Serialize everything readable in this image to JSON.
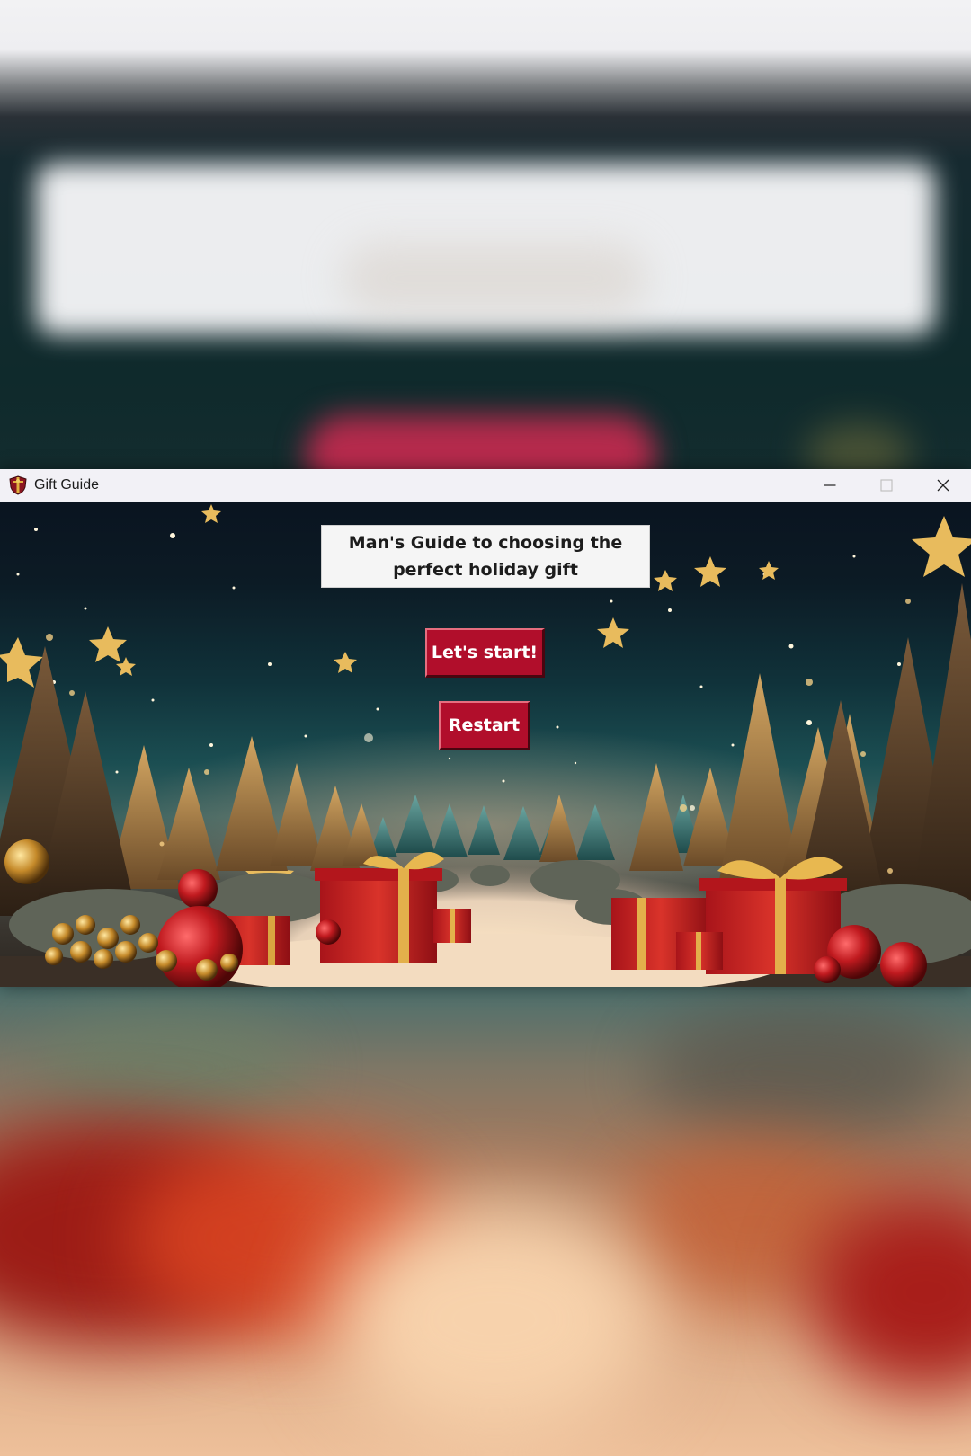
{
  "window": {
    "title": "Gift Guide",
    "icon": "gift-shield-icon",
    "controls": [
      "minimize-icon",
      "maximize-icon",
      "close-icon"
    ]
  },
  "main": {
    "heading": "Man's Guide to choosing the perfect holiday gift",
    "start_button": "Let's start!",
    "restart_button": "Restart"
  },
  "colors": {
    "button_bg": "#b10e2b",
    "heading_bg": "#f5f5f5",
    "titlebar_bg": "#f2f1f6"
  }
}
